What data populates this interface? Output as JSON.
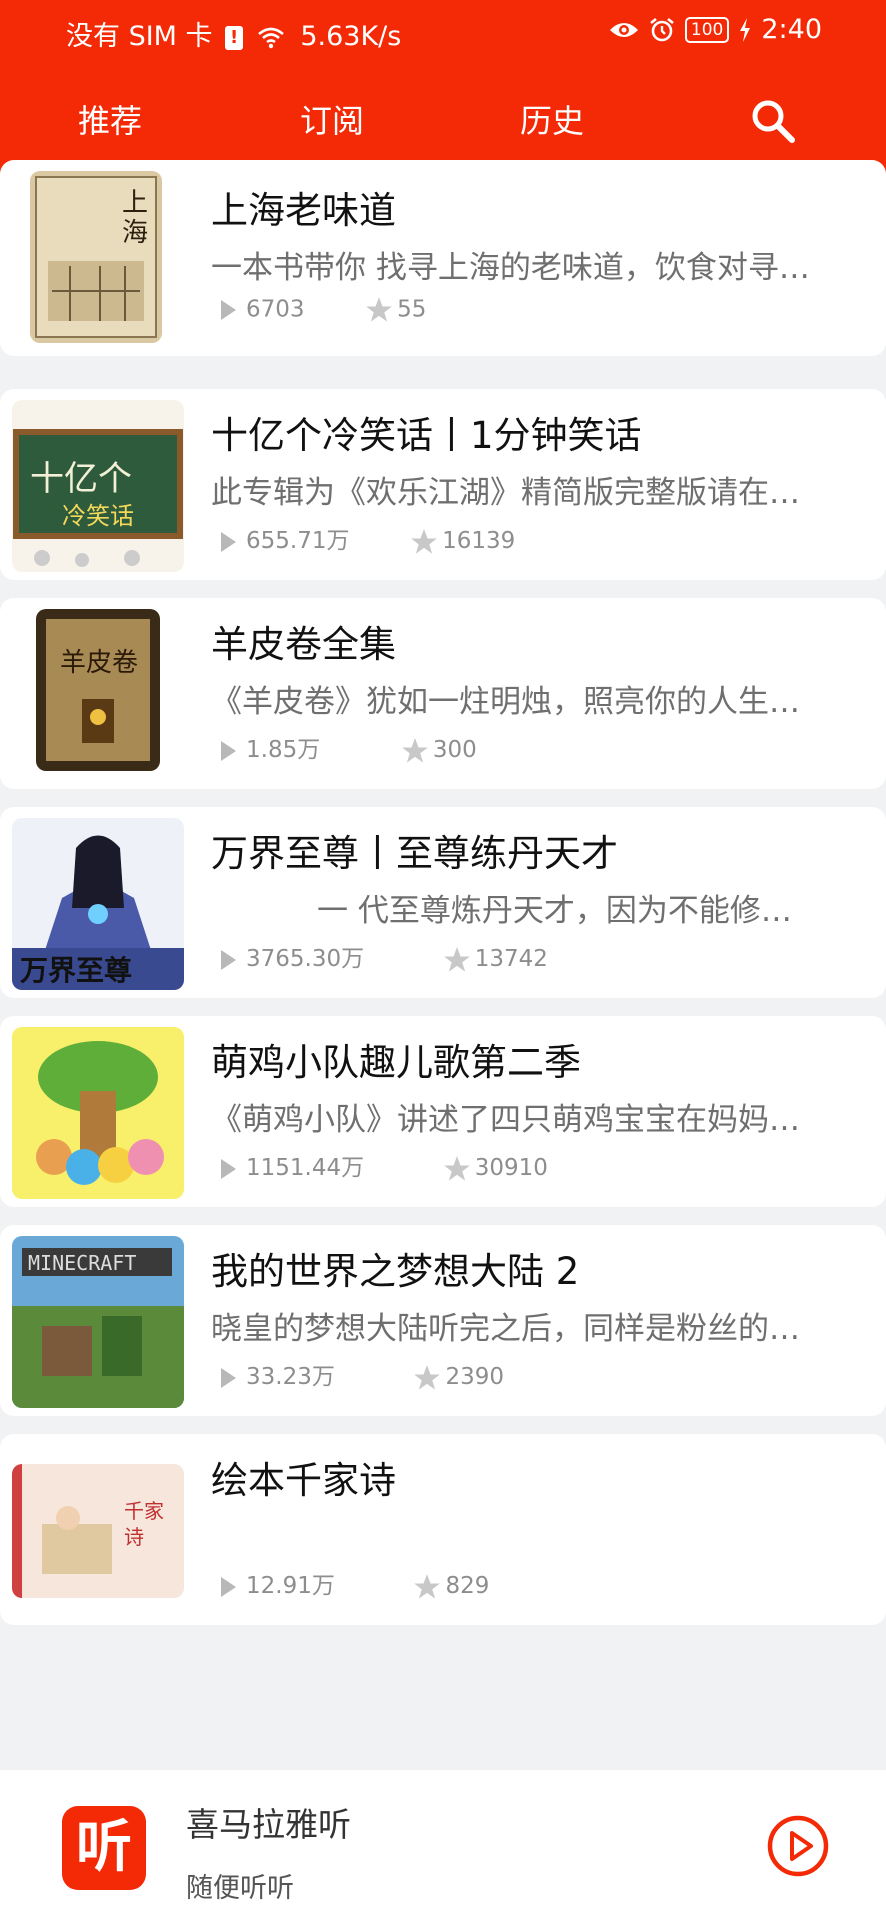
{
  "status": {
    "left": "没有 SIM 卡",
    "speed": "5.63K/s",
    "battery": "100",
    "time": "2:40"
  },
  "tabs": [
    "推荐",
    "订阅",
    "历史"
  ],
  "active_tab": "订阅",
  "icons": {
    "search": "search-icon",
    "play": "play-icon",
    "star": "star-icon"
  },
  "colors": {
    "brand": "#f42a07",
    "background": "#f1f2f4"
  },
  "items": [
    {
      "title": "上海老味道",
      "desc": "一本书带你 找寻上海的老味道，饮食对寻…",
      "plays": "6703",
      "favs": "55"
    },
    {
      "title": "十亿个冷笑话丨1分钟笑话",
      "desc": "此专辑为《欢乐江湖》精简版完整版请在…",
      "plays": "655.71万",
      "favs": "16139"
    },
    {
      "title": "羊皮卷全集",
      "desc": "《羊皮卷》犹如一炷明烛，照亮你的人生…",
      "plays": "1.85万",
      "favs": "300"
    },
    {
      "title": "万界至尊丨至尊练丹天才",
      "desc": "一 代至尊炼丹天才，因为不能修…",
      "plays": "3765.30万",
      "favs": "13742"
    },
    {
      "title": "萌鸡小队趣儿歌第二季",
      "desc": "《萌鸡小队》讲述了四只萌鸡宝宝在妈妈…",
      "plays": "1151.44万",
      "favs": "30910"
    },
    {
      "title": "我的世界之梦想大陆 2",
      "desc": "晓皇的梦想大陆听完之后，同样是粉丝的…",
      "plays": "33.23万",
      "favs": "2390"
    },
    {
      "title": "绘本千家诗",
      "desc": "",
      "plays": "12.91万",
      "favs": "829"
    }
  ],
  "bottom": {
    "logo_text": "听",
    "app_name": "喜马拉雅听",
    "subtitle": "随便听听"
  }
}
